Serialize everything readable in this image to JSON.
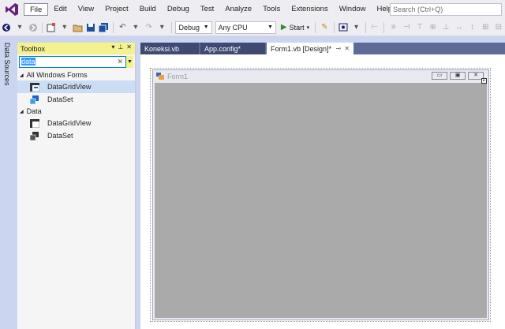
{
  "menu": {
    "items": [
      "File",
      "Edit",
      "View",
      "Project",
      "Build",
      "Debug",
      "Test",
      "Analyze",
      "Tools",
      "Extensions",
      "Window",
      "Help"
    ],
    "search_placeholder": "Search (Ctrl+Q)"
  },
  "toolbar": {
    "config": "Debug",
    "platform": "Any CPU",
    "start_label": "Start"
  },
  "side_tab": {
    "label": "Data Sources"
  },
  "toolbox": {
    "title": "Toolbox",
    "search_value": "data",
    "groups": [
      {
        "name": "All Windows Forms",
        "items": [
          "DataGridView",
          "DataSet"
        ]
      },
      {
        "name": "Data",
        "items": [
          "DataGridView",
          "DataSet"
        ]
      }
    ]
  },
  "tabs": [
    {
      "label": "Koneksi.vb"
    },
    {
      "label": "App.config*"
    },
    {
      "label": "Form1.vb [Design]*"
    }
  ],
  "form": {
    "title": "Form1"
  }
}
